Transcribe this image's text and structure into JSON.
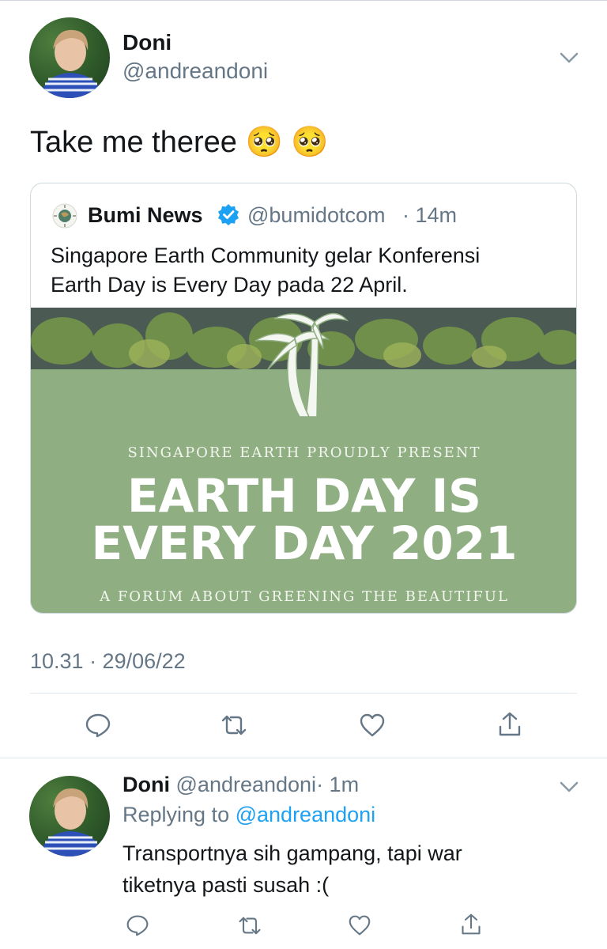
{
  "main_tweet": {
    "author_name": "Doni",
    "author_handle": "@andreandoni",
    "text": "Take me theree 🥺 🥺",
    "timestamp": "10.31 · 29/06/22",
    "icons": {
      "menu": "chevron-down-icon",
      "reply": "reply-icon",
      "retweet": "retweet-icon",
      "like": "heart-icon",
      "share": "share-icon"
    }
  },
  "quoted_tweet": {
    "author_name": "Bumi News",
    "verified": true,
    "author_handle": "@bumidotcom",
    "time": "· 14m",
    "text_line1": "Singapore Earth Community gelar Konferensi",
    "text_line2": "Earth Day is Every Day pada 22 April.",
    "poster": {
      "subtitle": "SINGAPORE EARTH PROUDLY PRESENT",
      "title_line1": "EARTH DAY IS",
      "title_line2": "EVERY DAY 2021",
      "tagline": "A FORUM ABOUT GREENING THE BEAUTIFUL",
      "background_color": "#8fae82"
    }
  },
  "reply_tweet": {
    "author_name": "Doni",
    "author_handle": "@andreandoni",
    "time": "· 1m",
    "replying_prefix": "Replying to",
    "replying_to": "@andreandoni",
    "text_line1": "Transportnya sih gampang, tapi war",
    "text_line2": "tiketnya pasti susah :("
  },
  "colors": {
    "accent": "#1da1f2",
    "muted": "#657786",
    "divider": "#e1e8ed"
  }
}
